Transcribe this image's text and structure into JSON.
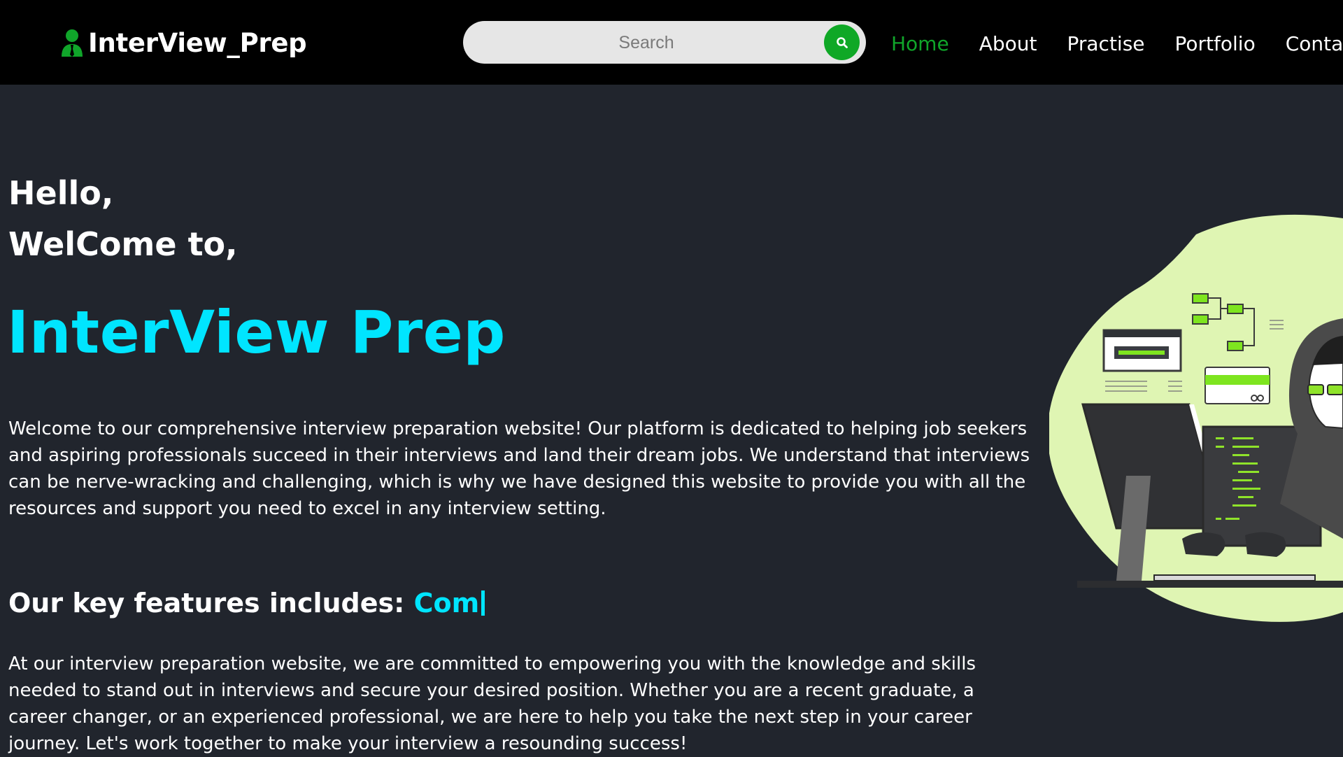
{
  "brand": {
    "name": "InterView_Prep"
  },
  "search": {
    "placeholder": "Search"
  },
  "nav": {
    "items": [
      {
        "label": "Home",
        "active": true
      },
      {
        "label": "About",
        "active": false
      },
      {
        "label": "Practise",
        "active": false
      },
      {
        "label": "Portfolio",
        "active": false
      },
      {
        "label": "Contact",
        "active": false
      }
    ]
  },
  "hero": {
    "greeting_line1": "Hello,",
    "greeting_line2": "WelCome to,",
    "title": "InterView Prep",
    "description": "Welcome to our comprehensive interview preparation website! Our platform is dedicated to helping job seekers and aspiring professionals succeed in their interviews and land their dream jobs. We understand that interviews can be nerve-wracking and challenging, which is why we have designed this website to provide you with all the resources and support you need to excel in any interview setting."
  },
  "features": {
    "heading": "Our key features includes: ",
    "typed_text": "Com"
  },
  "closing": {
    "description": "At our interview preparation website, we are committed to empowering you with the knowledge and skills needed to stand out in interviews and secure your desired position. Whether you are a recent graduate, a career changer, or an experienced professional, we are here to help you take the next step in your career journey. Let's work together to make your interview a resounding success!"
  },
  "colors": {
    "accent_cyan": "#00e5ff",
    "accent_green": "#0fa826",
    "illustration_lime": "#dff5b3",
    "background": "#21252d",
    "navbar": "#000000"
  },
  "icons": {
    "brand": "user-tie-icon",
    "search": "search-icon"
  }
}
